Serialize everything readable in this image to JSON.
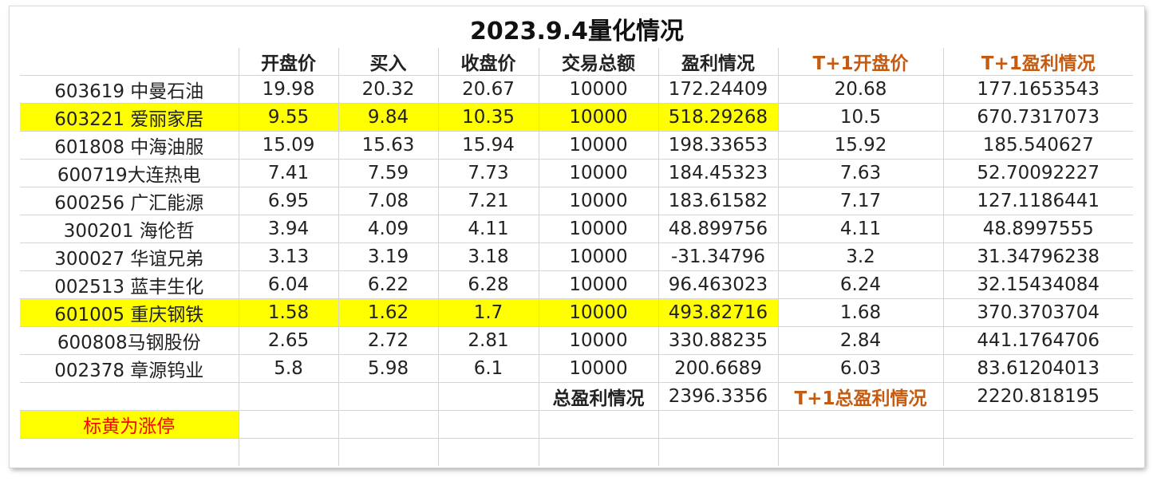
{
  "title": "2023.9.4量化情况",
  "headers": [
    "",
    "开盘价",
    "买入",
    "收盘价",
    "交易总额",
    "盈利情况",
    "T+1开盘价",
    "T+1盈利情况"
  ],
  "rows": [
    {
      "name": "603619 中曼石油",
      "open": "19.98",
      "buy": "20.32",
      "close": "20.67",
      "total": "10000",
      "profit": "172.24409",
      "t1_open": "20.68",
      "t1_profit": "177.1653543",
      "limit_up": false
    },
    {
      "name": "603221 爱丽家居",
      "open": "9.55",
      "buy": "9.84",
      "close": "10.35",
      "total": "10000",
      "profit": "518.29268",
      "t1_open": "10.5",
      "t1_profit": "670.7317073",
      "limit_up": true
    },
    {
      "name": "601808 中海油服",
      "open": "15.09",
      "buy": "15.63",
      "close": "15.94",
      "total": "10000",
      "profit": "198.33653",
      "t1_open": "15.92",
      "t1_profit": "185.540627",
      "limit_up": false
    },
    {
      "name": "600719大连热电",
      "open": "7.41",
      "buy": "7.59",
      "close": "7.73",
      "total": "10000",
      "profit": "184.45323",
      "t1_open": "7.63",
      "t1_profit": "52.70092227",
      "limit_up": false
    },
    {
      "name": "600256 广汇能源",
      "open": "6.95",
      "buy": "7.08",
      "close": "7.21",
      "total": "10000",
      "profit": "183.61582",
      "t1_open": "7.17",
      "t1_profit": "127.1186441",
      "limit_up": false
    },
    {
      "name": "300201 海伦哲",
      "open": "3.94",
      "buy": "4.09",
      "close": "4.11",
      "total": "10000",
      "profit": "48.899756",
      "t1_open": "4.11",
      "t1_profit": "48.8997555",
      "limit_up": false
    },
    {
      "name": "300027 华谊兄弟",
      "open": "3.13",
      "buy": "3.19",
      "close": "3.18",
      "total": "10000",
      "profit": "-31.34796",
      "t1_open": "3.2",
      "t1_profit": "31.34796238",
      "limit_up": false
    },
    {
      "name": "002513 蓝丰生化",
      "open": "6.04",
      "buy": "6.22",
      "close": "6.28",
      "total": "10000",
      "profit": "96.463023",
      "t1_open": "6.24",
      "t1_profit": "32.15434084",
      "limit_up": false
    },
    {
      "name": "601005 重庆钢铁",
      "open": "1.58",
      "buy": "1.62",
      "close": "1.7",
      "total": "10000",
      "profit": "493.82716",
      "t1_open": "1.68",
      "t1_profit": "370.3703704",
      "limit_up": true
    },
    {
      "name": "600808马钢股份",
      "open": "2.65",
      "buy": "2.72",
      "close": "2.81",
      "total": "10000",
      "profit": "330.88235",
      "t1_open": "2.84",
      "t1_profit": "441.1764706",
      "limit_up": false
    },
    {
      "name": "002378 章源钨业",
      "open": "5.8",
      "buy": "5.98",
      "close": "6.1",
      "total": "10000",
      "profit": "200.6689",
      "t1_open": "6.03",
      "t1_profit": "83.61204013",
      "limit_up": false
    }
  ],
  "summary": {
    "total_label": "总盈利情况",
    "total_value": "2396.3356",
    "t1_total_label": "T+1总盈利情况",
    "t1_total_value": "2220.818195"
  },
  "legend_note": "标黄为涨停",
  "colors": {
    "highlight": "#ffff00",
    "header_t1": "#c55a11",
    "note": "#ff0000"
  }
}
